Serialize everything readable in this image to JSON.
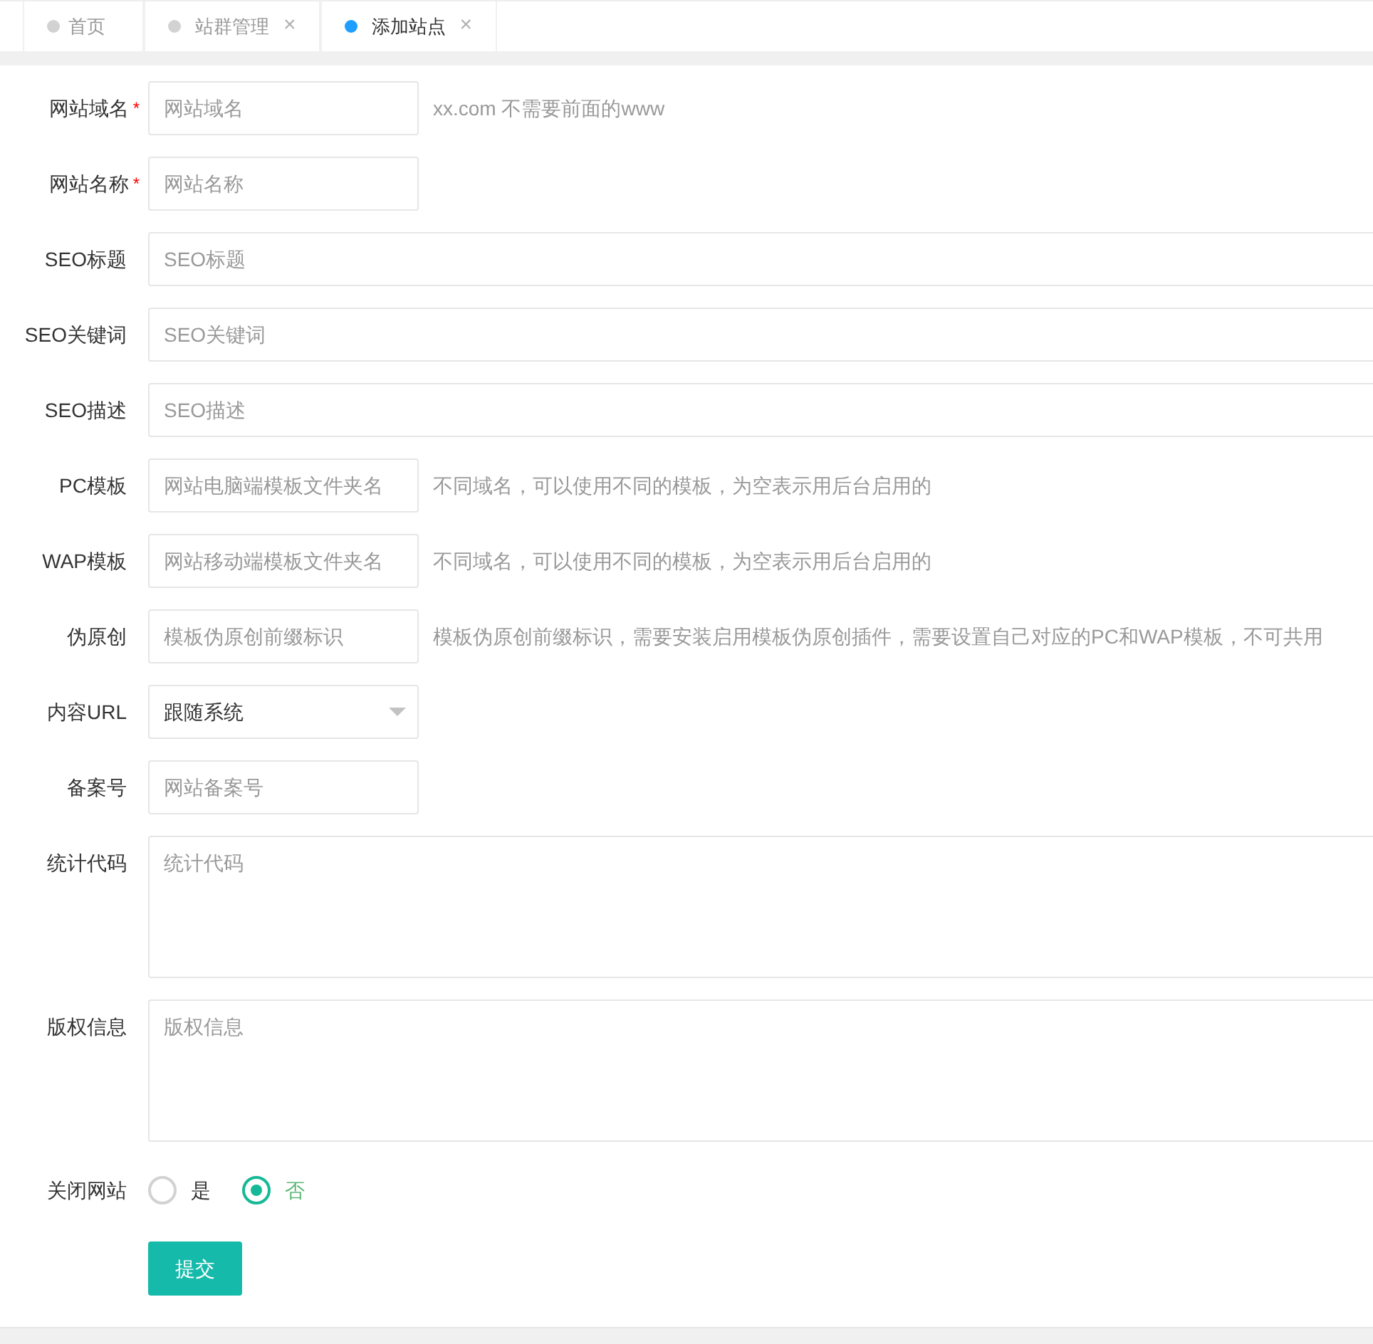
{
  "tabs": [
    {
      "label": "首页",
      "selected": false
    },
    {
      "label": "站群管理",
      "selected": false,
      "close": "×"
    },
    {
      "label": "添加站点",
      "selected": true,
      "close": "×"
    }
  ],
  "fields": [
    {
      "kind": "short",
      "label": "网站域名",
      "mark": "*",
      "placeholder": "网站域名",
      "hint": "xx.com 不需要前面的www"
    },
    {
      "kind": "short",
      "label": "网站名称",
      "mark": "*",
      "placeholder": "网站名称"
    },
    {
      "kind": "wide",
      "label": "SEO标题",
      "placeholder": "SEO标题"
    },
    {
      "kind": "wide",
      "label": "SEO关键词",
      "placeholder": "SEO关键词"
    },
    {
      "kind": "wide",
      "label": "SEO描述",
      "placeholder": "SEO描述"
    },
    {
      "kind": "short",
      "label": "PC模板",
      "placeholder": "网站电脑端模板文件夹名",
      "hint": "不同域名，可以使用不同的模板，为空表示用后台启用的"
    },
    {
      "kind": "short",
      "label": "WAP模板",
      "placeholder": "网站移动端模板文件夹名",
      "hint": "不同域名，可以使用不同的模板，为空表示用后台启用的"
    },
    {
      "kind": "short",
      "label": "伪原创",
      "placeholder": "模板伪原创前缀标识",
      "hint": "模板伪原创前缀标识，需要安装启用模板伪原创插件，需要设置自己对应的PC和WAP模板，不可共用"
    },
    {
      "kind": "select",
      "label": "内容URL",
      "value": "跟随系统"
    },
    {
      "kind": "short",
      "label": "备案号",
      "placeholder": "网站备案号"
    },
    {
      "kind": "textarea",
      "label": "统计代码",
      "placeholder": "统计代码"
    },
    {
      "kind": "textarea",
      "label": "版权信息",
      "placeholder": "版权信息"
    },
    {
      "kind": "radio",
      "label": "关闭网站",
      "options": [
        {
          "label": "是",
          "selected": false
        },
        {
          "label": "否",
          "selected": true
        }
      ]
    }
  ],
  "submit": "提交"
}
